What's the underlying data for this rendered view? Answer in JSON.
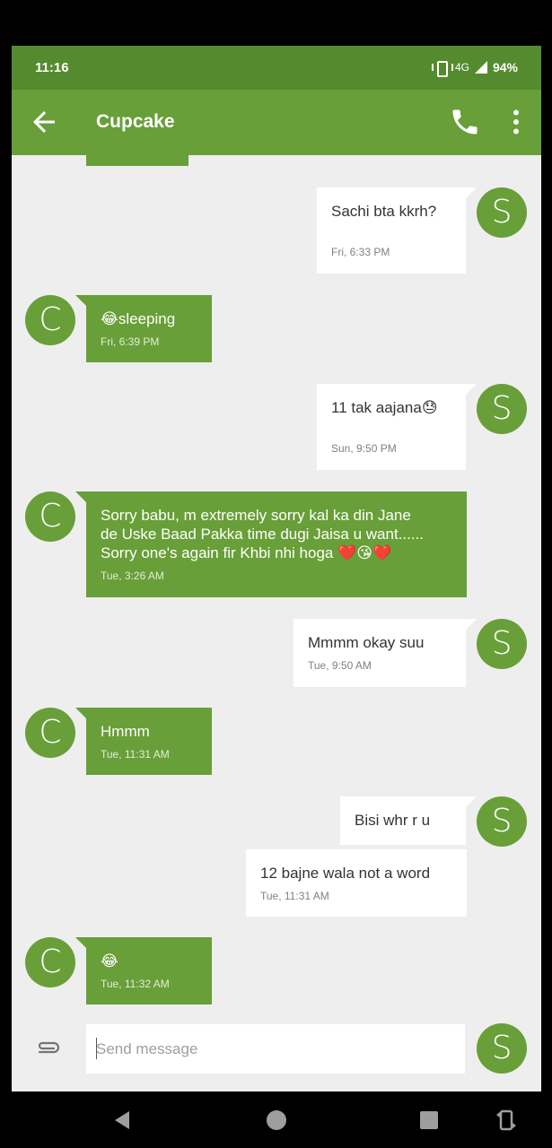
{
  "status_bar": {
    "time": "11:16",
    "network": "4G",
    "battery": "94%"
  },
  "toolbar": {
    "title": "Cupcake",
    "back_icon": "arrow-left-icon",
    "call_icon": "phone-icon",
    "more_icon": "more-vert-icon"
  },
  "avatars": {
    "contact_initial": "C",
    "self_initial": "S"
  },
  "messages": [
    {
      "direction": "out",
      "text": "Sachi bta kkrh?",
      "time": "Fri, 6:33 PM"
    },
    {
      "direction": "in",
      "text": "😂sleeping",
      "time": "Fri, 6:39 PM"
    },
    {
      "direction": "out",
      "text": "11 tak aajana😓",
      "time": "Sun, 9:50 PM"
    },
    {
      "direction": "in",
      "lines": [
        "Sorry babu, m extremely sorry kal ka din Jane",
        "de Uske Baad Pakka time dugi Jaisa u want......",
        "Sorry one's again fir Khbi nhi hoga ❤️😘❤️"
      ],
      "time": "Tue, 3:26 AM"
    },
    {
      "direction": "out",
      "text": "Mmmm okay suu",
      "time": "Tue, 9:50 AM"
    },
    {
      "direction": "in",
      "text": "Hmmm",
      "time": "Tue, 11:31 AM"
    },
    {
      "direction": "out",
      "text": "Bisi whr r u",
      "time": ""
    },
    {
      "direction": "out",
      "text": "12 bajne wala not a word",
      "time": "Tue, 11:31 AM"
    },
    {
      "direction": "in",
      "text": "😂",
      "time": "Tue, 11:32 AM"
    }
  ],
  "compose": {
    "placeholder": "Send message",
    "value": "",
    "attach_icon": "paperclip-icon"
  },
  "nav_bar": {
    "back_icon": "nav-back-icon",
    "home_icon": "nav-home-icon",
    "recents_icon": "nav-recents-icon",
    "rotate_icon": "rotate-icon"
  },
  "colors": {
    "status_bar": "#558b2f",
    "toolbar": "#689f38",
    "incoming_bubble": "#689f38",
    "outgoing_bubble": "#ffffff",
    "background": "#eeeeee"
  }
}
